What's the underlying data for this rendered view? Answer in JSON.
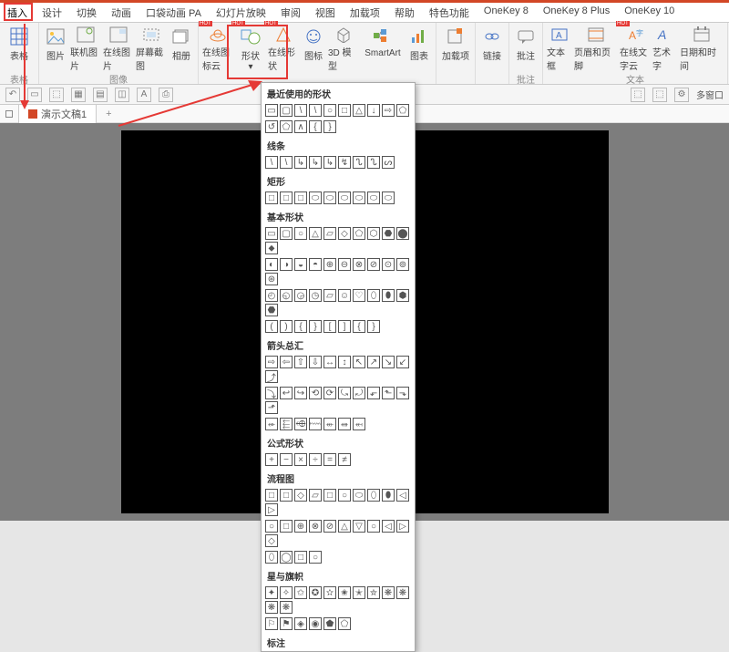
{
  "tabs": [
    "插入",
    "设计",
    "切换",
    "动画",
    "口袋动画 PA",
    "幻灯片放映",
    "审阅",
    "视图",
    "加载项",
    "帮助",
    "特色功能",
    "OneKey 8",
    "OneKey 8 Plus",
    "OneKey 10"
  ],
  "active_tab": 0,
  "groups": {
    "g0": {
      "label": "表格",
      "btns": [
        {
          "l": "表格"
        }
      ]
    },
    "g1": {
      "label": "图像",
      "btns": [
        {
          "l": "图片"
        },
        {
          "l": "联机图片"
        },
        {
          "l": "在线图片"
        },
        {
          "l": "屏幕截图"
        },
        {
          "l": "相册"
        }
      ]
    },
    "g2": {
      "label": "",
      "btns": [
        {
          "l": "在线图标云",
          "hot": true
        },
        {
          "l": "形状",
          "hot": true
        },
        {
          "l": "在线形状",
          "hot": true
        },
        {
          "l": "图标"
        },
        {
          "l": "3D 模型"
        },
        {
          "l": "SmartArt"
        },
        {
          "l": "图表"
        }
      ]
    },
    "g3": {
      "label": "",
      "btns": [
        {
          "l": "加载项"
        }
      ]
    },
    "g4": {
      "label": "",
      "btns": [
        {
          "l": "链接"
        }
      ]
    },
    "g5": {
      "label": "批注",
      "btns": [
        {
          "l": "批注"
        }
      ]
    },
    "g6": {
      "label": "文本",
      "btns": [
        {
          "l": "文本框"
        },
        {
          "l": "页眉和页脚"
        },
        {
          "l": "在线文字云",
          "hot": true
        },
        {
          "l": "艺术字"
        },
        {
          "l": "日期和时间"
        }
      ]
    }
  },
  "doc": {
    "title": "演示文稿1"
  },
  "sidebar": {
    "label": "多窗口"
  },
  "dropdown": {
    "s0": {
      "title": "最近使用的形状",
      "rows": [
        [
          "▭",
          "▢",
          "\\",
          "\\",
          "○",
          "□",
          "△",
          "↓",
          "⇨",
          "⬠"
        ],
        [
          "↺",
          "⬠",
          "∧",
          "{",
          "}"
        ]
      ]
    },
    "s1": {
      "title": "线条",
      "rows": [
        [
          "\\",
          "\\",
          "↳",
          "↳",
          "↳",
          "↯",
          "ᔐ",
          "ᔐ",
          "ᔕ"
        ]
      ]
    },
    "s2": {
      "title": "矩形",
      "rows": [
        [
          "□",
          "□",
          "□",
          "⬭",
          "⬭",
          "⬭",
          "⬭",
          "⬭",
          "⬭"
        ]
      ]
    },
    "s3": {
      "title": "基本形状",
      "rows": [
        [
          "▭",
          "▢",
          "○",
          "△",
          "▱",
          "◇",
          "⬠",
          "⬡",
          "⬣",
          "⬤",
          "⬥"
        ],
        [
          "◐",
          "◑",
          "◒",
          "◓",
          "⊕",
          "⊖",
          "⊗",
          "⊘",
          "⊙",
          "⊚",
          "⊛"
        ],
        [
          "◴",
          "◵",
          "◶",
          "◷",
          "▱",
          "☺",
          "♡",
          "⬯",
          "⬮",
          "⬢",
          "⬣"
        ],
        [
          "(",
          ")",
          "{",
          "}",
          "[",
          "]",
          "{",
          "}"
        ]
      ]
    },
    "s4": {
      "title": "箭头总汇",
      "rows": [
        [
          "⇨",
          "⇦",
          "⇧",
          "⇩",
          "↔",
          "↕",
          "↖",
          "↗",
          "↘",
          "↙",
          "⤴"
        ],
        [
          "⤵",
          "↩",
          "↪",
          "⟲",
          "⟳",
          "⤿",
          "⤾",
          "⬐",
          "⬑",
          "⬎",
          "⬏"
        ],
        [
          "⬰",
          "⬱",
          "⬲",
          "⬳",
          "⬴",
          "⬵",
          "⬶"
        ]
      ]
    },
    "s5": {
      "title": "公式形状",
      "rows": [
        [
          "+",
          "−",
          "×",
          "÷",
          "=",
          "≠"
        ]
      ]
    },
    "s6": {
      "title": "流程图",
      "rows": [
        [
          "□",
          "□",
          "◇",
          "▱",
          "□",
          "○",
          "⬭",
          "⬯",
          "⬮",
          "◁",
          "▷"
        ],
        [
          "○",
          "□",
          "⊕",
          "⊗",
          "⊘",
          "△",
          "▽",
          "○",
          "◁",
          "▷",
          "◇"
        ],
        [
          "⬯",
          "◯",
          "□",
          "○"
        ]
      ]
    },
    "s7": {
      "title": "星与旗帜",
      "rows": [
        [
          "✦",
          "✧",
          "✩",
          "✪",
          "✫",
          "✬",
          "✭",
          "✮",
          "❋",
          "❋",
          "❋",
          "❋"
        ],
        [
          "⚐",
          "⚑",
          "◈",
          "◉",
          "⬟",
          "⬠"
        ]
      ]
    },
    "s8": {
      "title": "标注",
      "rows": []
    }
  },
  "annotations": {
    "box_insert": true,
    "box_shapes": true,
    "box_triangle": true
  }
}
